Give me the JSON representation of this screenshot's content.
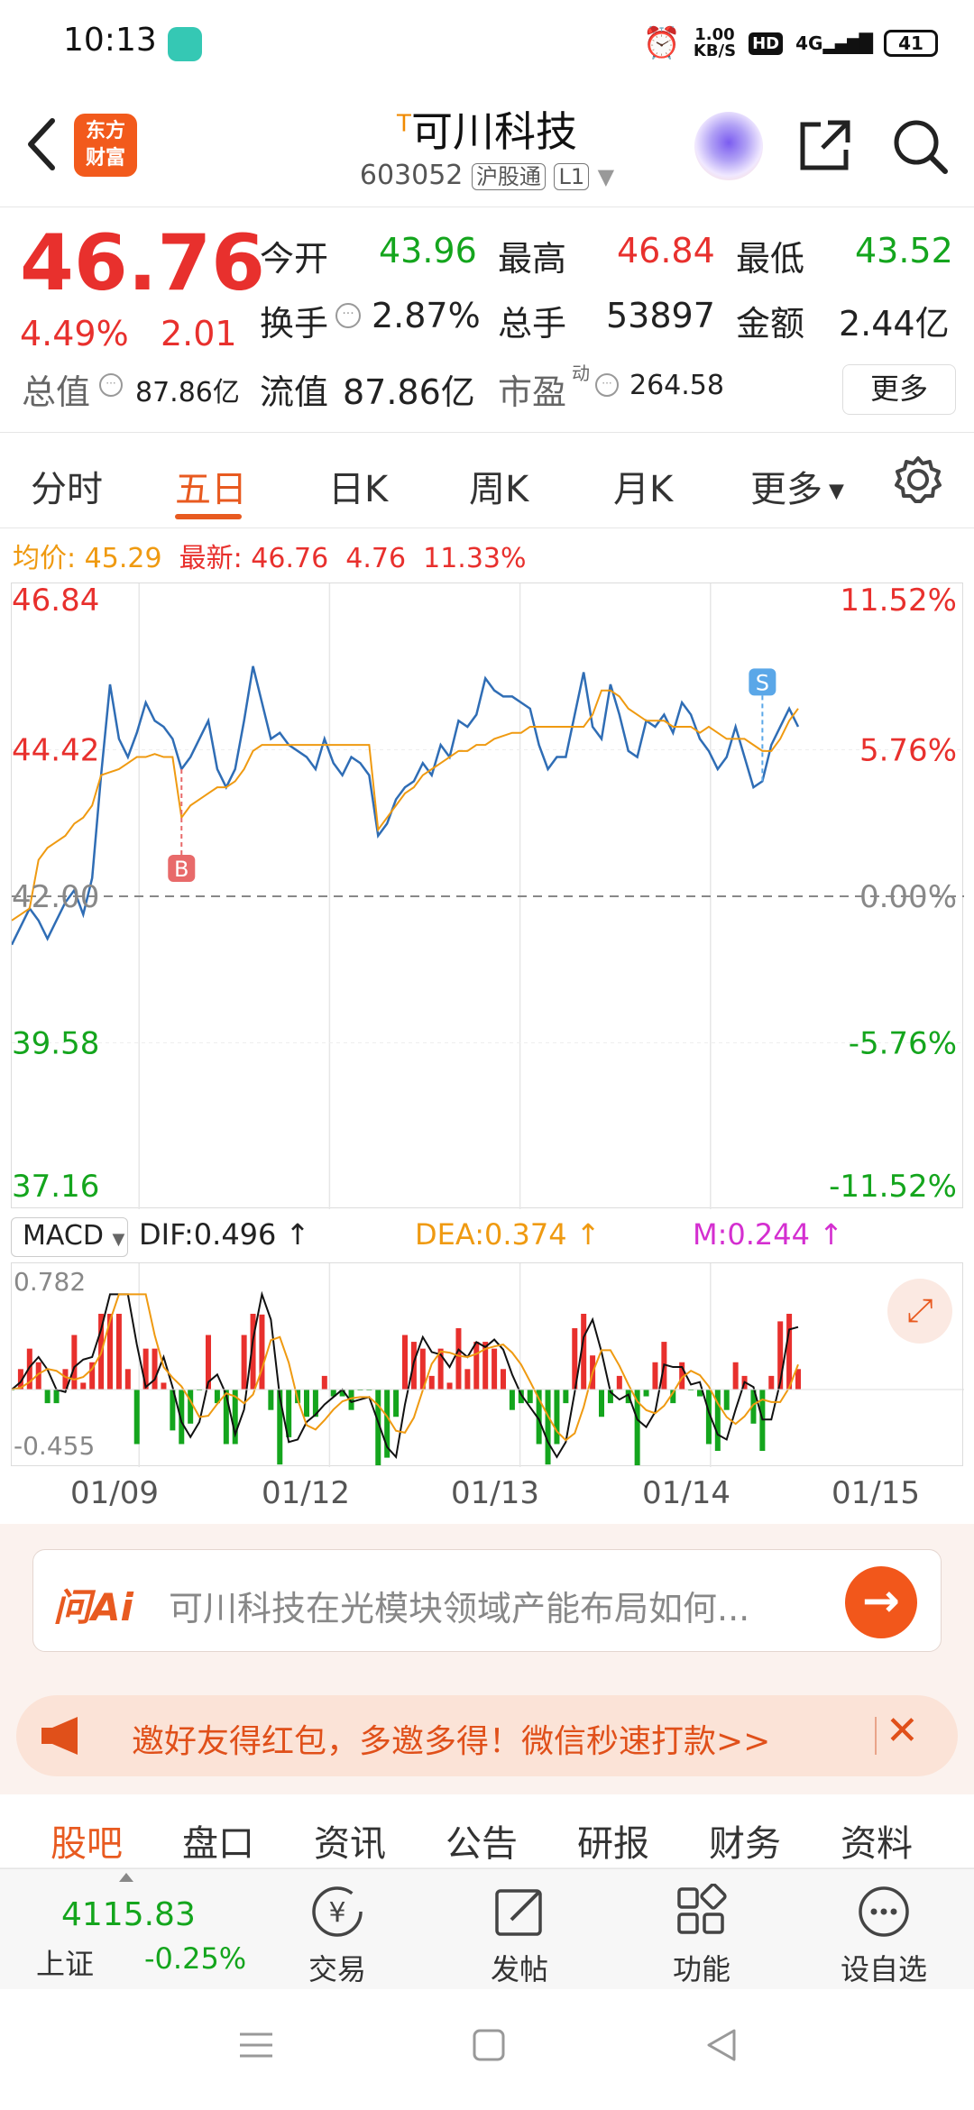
{
  "status_bar": {
    "time": "10:13",
    "net_speed": "1.00\nKB/S",
    "net_speed_value": "1.00",
    "net_speed_unit": "KB/S",
    "hd": "HD",
    "signal": "4G",
    "battery": "41"
  },
  "header": {
    "logo": "东方财富",
    "logo_line1": "东方",
    "logo_line2": "财富",
    "stock_prefix": "T",
    "stock_name": "可川科技",
    "stock_code": "603052",
    "market_tag": "沪股通",
    "level_tag": "L1"
  },
  "quote": {
    "price": "46.76",
    "change_pct": "4.49%",
    "change": "2.01",
    "open_label": "今开",
    "open": "43.96",
    "high_label": "最高",
    "high": "46.84",
    "low_label": "最低",
    "low": "43.52",
    "turnover_label": "换手",
    "turnover": "2.87%",
    "volume_label": "总手",
    "volume": "53897",
    "amount_label": "金额",
    "amount": "2.44亿",
    "total_value_label": "总值",
    "total_value": "87.86亿",
    "float_value_label": "流值",
    "float_value": "87.86亿",
    "pe_label": "市盈",
    "pe_sup": "动",
    "pe": "264.58",
    "more": "更多"
  },
  "tabs": [
    "分时",
    "五日",
    "日K",
    "周K",
    "月K",
    "更多"
  ],
  "active_tab": "五日",
  "chart_info": {
    "avg_label": "均价:",
    "avg": "45.29",
    "latest_label": "最新:",
    "latest": "46.76",
    "change": "4.76",
    "pct": "11.33%"
  },
  "chart_data": {
    "type": "line",
    "x": [
      "01/09",
      "01/12",
      "01/13",
      "01/14",
      "01/15"
    ],
    "ylim": [
      37.16,
      46.84
    ],
    "y_ticks_left": [
      "46.84",
      "44.42",
      "42.00",
      "39.58",
      "37.16"
    ],
    "y_ticks_right": [
      "11.52%",
      "5.76%",
      "0.00%",
      "-5.76%",
      "-11.52%"
    ],
    "prev_close": 42.0,
    "series": [
      {
        "values": [
          41.2,
          41.5,
          41.8,
          41.6,
          41.3,
          41.6,
          41.9,
          42.1,
          41.7,
          42.3,
          44.0,
          45.5,
          44.6,
          44.3,
          44.7,
          45.2,
          44.9,
          44.8,
          44.6,
          44.1,
          44.3,
          44.6,
          44.9,
          44.1,
          43.8,
          44.1,
          44.9,
          45.8,
          45.2,
          44.6,
          44.7,
          44.5,
          44.4,
          44.3,
          44.1,
          44.6,
          44.2,
          44.0,
          44.3,
          44.2,
          44.0,
          43.0,
          43.2,
          43.6,
          43.8,
          43.9,
          44.2,
          44.0,
          44.5,
          44.3,
          44.9,
          44.8,
          45.0,
          45.6,
          45.4,
          45.3,
          45.3,
          45.2,
          45.1,
          44.5,
          44.1,
          44.3,
          44.3,
          45.0,
          45.7,
          44.8,
          44.6,
          45.5,
          45.0,
          44.4,
          44.3,
          44.9,
          44.8,
          45.0,
          44.7,
          45.2,
          45.0,
          44.6,
          44.4,
          44.1,
          44.3,
          44.8,
          44.3,
          43.8,
          43.9,
          44.5,
          44.8,
          45.1,
          44.8
        ]
      },
      {
        "values": [
          41.6,
          41.7,
          41.8,
          42.6,
          42.8,
          42.9,
          43.0,
          43.2,
          43.3,
          43.5,
          44.0,
          44.05,
          44.1,
          44.2,
          44.3,
          44.3,
          44.35,
          44.3,
          44.3,
          43.3,
          43.5,
          43.6,
          43.7,
          43.8,
          43.8,
          43.9,
          44.1,
          44.4,
          44.5,
          44.5,
          44.5,
          44.5,
          44.5,
          44.5,
          44.5,
          44.5,
          44.5,
          44.5,
          44.5,
          44.5,
          44.5,
          43.1,
          43.3,
          43.5,
          43.7,
          43.8,
          44.0,
          44.1,
          44.2,
          44.3,
          44.4,
          44.4,
          44.5,
          44.5,
          44.6,
          44.65,
          44.7,
          44.7,
          44.8,
          44.8,
          44.8,
          44.8,
          44.8,
          44.8,
          44.8,
          45.0,
          45.4,
          45.4,
          45.3,
          45.1,
          45.0,
          44.9,
          44.9,
          44.9,
          44.8,
          44.8,
          44.8,
          44.7,
          44.8,
          44.7,
          44.6,
          44.6,
          44.6,
          44.5,
          44.4,
          44.4,
          44.6,
          44.9,
          45.1
        ]
      }
    ],
    "markers": [
      {
        "label": "B",
        "x_index": 19
      },
      {
        "label": "S",
        "x_index": 84
      }
    ]
  },
  "macd": {
    "name": "MACD",
    "dif_label": "DIF:0.496",
    "dea_label": "DEA:0.374",
    "m_label": "M:0.244",
    "ymax": "0.782",
    "ymin": "-0.455",
    "dif_value": 0.496,
    "dea_value": 0.374,
    "m_value": 0.244
  },
  "dates": [
    "01/09",
    "01/12",
    "01/13",
    "01/14",
    "01/15"
  ],
  "ai": {
    "logo": "问Ai",
    "text": "可川科技在光模块领域产能布局如何..."
  },
  "promo": {
    "text": "邀好友得红包，多邀多得！微信秒速打款>>"
  },
  "subtabs": [
    "股吧",
    "盘口",
    "资讯",
    "公告",
    "研报",
    "财务",
    "资料"
  ],
  "active_subtab": "股吧",
  "toolbar": {
    "index_value": "4115.83",
    "index_name": "上证",
    "index_change": "-0.25%",
    "trade": "交易",
    "post": "发帖",
    "functions": "功能",
    "watchlist": "设自选"
  },
  "colors": {
    "up": "#e8302d",
    "down": "#14a51d",
    "accent": "#e85a20",
    "price_line": "#2f6db5",
    "avg_line": "#ef9a11"
  }
}
